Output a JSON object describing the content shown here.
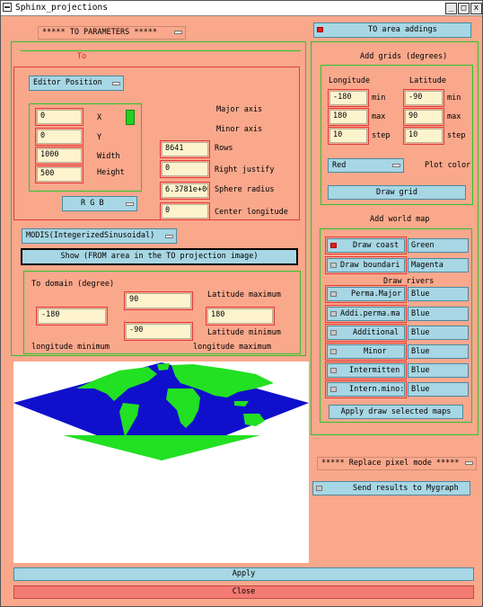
{
  "window": {
    "title": "Sphinx_projections",
    "btn_minimize": "_",
    "btn_maximize": "□",
    "btn_close": "x"
  },
  "top_mode_dropdown": "***** TO PARAMETERS *****",
  "to_area_toggle": "TO area addings",
  "to_group": {
    "title": "To",
    "editor_position": "Editor Position",
    "x_value": "0",
    "x_label": "X",
    "y_value": "0",
    "y_label": "Y",
    "width_value": "1000",
    "width_label": "Width",
    "height_value": "500",
    "height_label": "Height",
    "rgb_dropdown": "R G B",
    "major_axis_label": "Major axis",
    "minor_axis_label": "Minor axis",
    "rows_value": "8641",
    "rows_label": "Rows",
    "right_justify_value": "0",
    "right_justify_label": "Right justify",
    "sphere_radius_value": "6.3781e+06",
    "sphere_radius_label": "Sphere radius",
    "center_longitude_value": "0",
    "center_longitude_label": "Center longitude"
  },
  "projection_dropdown": "MODIS(IntegerizedSinusoidal)",
  "show_button": "Show (FROM area in the TO projection image)",
  "domain": {
    "title": "To domain (degree)",
    "lat_max_value": "90",
    "lat_max_label": "Latitude maximum",
    "lon_min_value": "-180",
    "lon_min_label": "longitude minimum",
    "lat_min_value": "-90",
    "lat_min_label": "Latitude minimum",
    "lon_max_value": "180",
    "lon_max_label": "longitude maximum"
  },
  "grids": {
    "title": "Add grids (degrees)",
    "longitude_header": "Longitude",
    "latitude_header": "Latitude",
    "lon_min_value": "-180",
    "lon_max_value": "180",
    "lon_step_value": "10",
    "lat_min_value": "-90",
    "lat_max_value": "90",
    "lat_step_value": "10",
    "min_label": "min",
    "max_label": "max",
    "step_label": "step",
    "color_dropdown": "Red",
    "plot_color_label": "Plot color",
    "draw_grid_button": "Draw grid"
  },
  "world_map": {
    "title": "Add world map",
    "draw_coast": "Draw coast",
    "coast_color": "Green",
    "draw_boundaries": "Draw boundari",
    "boundaries_color": "Magenta",
    "rivers_title": "Draw rivers",
    "rivers": [
      {
        "label": "Perma.Major",
        "color": "Blue"
      },
      {
        "label": "Addi.perma.ma",
        "color": "Blue"
      },
      {
        "label": "Additional",
        "color": "Blue"
      },
      {
        "label": "Minor",
        "color": "Blue"
      },
      {
        "label": "Intermitten",
        "color": "Blue"
      },
      {
        "label": "Intern.mino:",
        "color": "Blue"
      }
    ],
    "apply_selected_button": "Apply draw selected maps"
  },
  "replace_mode_dropdown": "***** Replace pixel mode *****",
  "send_results_toggle": "Send results to Mygraph",
  "apply_button": "Apply",
  "close_button": "Close",
  "colors": {
    "background": "#f9a88c",
    "button": "#a7d6e4",
    "close": "#f47a74",
    "input": "#fdf4ce",
    "group_border": "#29c629",
    "field_border": "#e23a3a",
    "ocean": "#1010cc",
    "land": "#22e022"
  }
}
